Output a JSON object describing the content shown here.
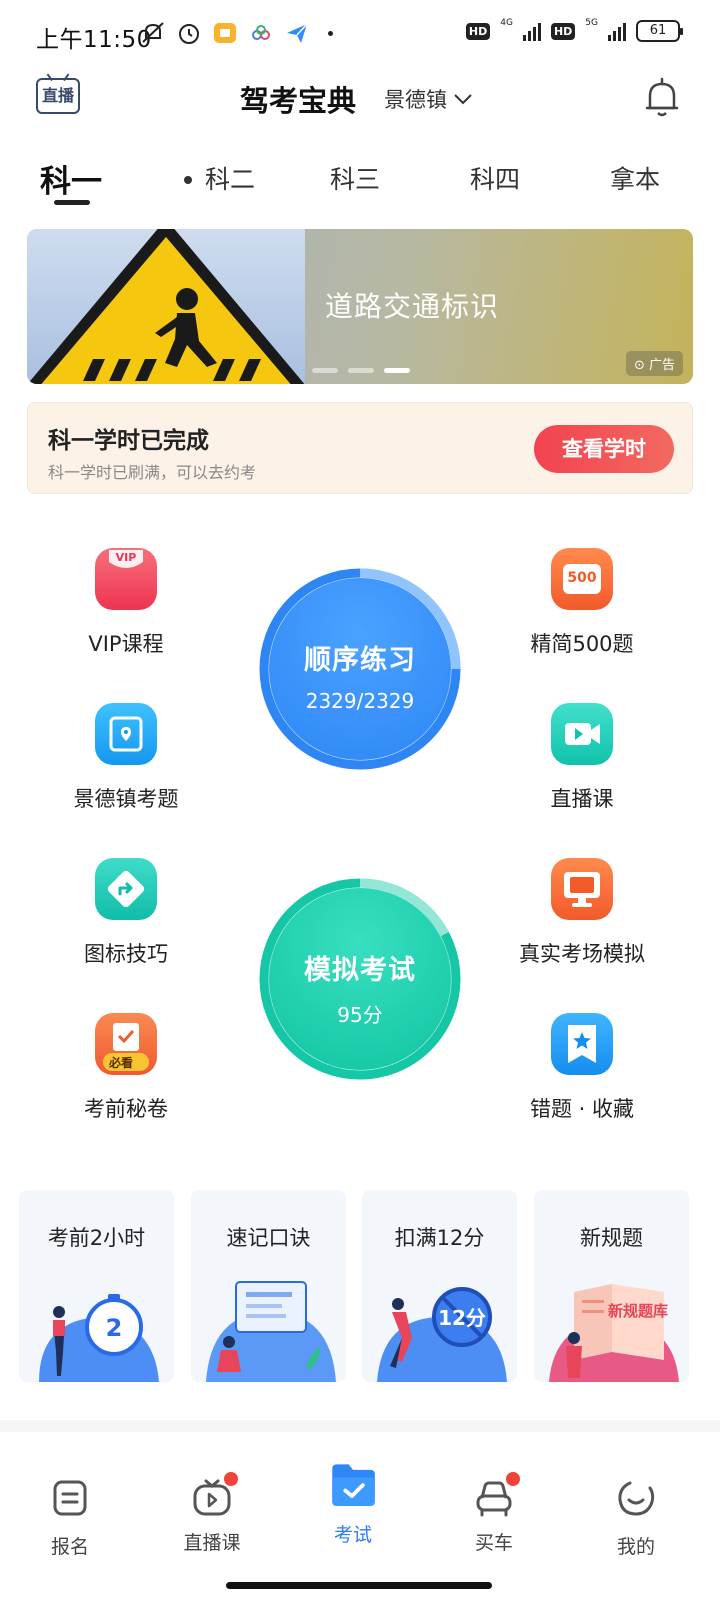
{
  "status_bar": {
    "time": "上午11:50",
    "net1": "4G",
    "net2": "5G",
    "hd": "HD",
    "battery": "61"
  },
  "header": {
    "live_label": "直播",
    "title": "驾考宝典",
    "city": "景德镇"
  },
  "tabs": [
    {
      "label": "科一",
      "active": true
    },
    {
      "label": "科二",
      "active": false
    },
    {
      "label": "科三",
      "active": false
    },
    {
      "label": "科四",
      "active": false
    },
    {
      "label": "拿本",
      "active": false
    }
  ],
  "banner": {
    "text": "道路交通标识",
    "ad_label": "广告",
    "page_count": 3,
    "current_page": 3
  },
  "study_hours": {
    "title": "科一学时已完成",
    "subtitle": "科一学时已刷满，可以去约考",
    "button": "查看学时"
  },
  "features_left": [
    {
      "label": "VIP课程",
      "icon": "vip-icon",
      "color": "#f2465a"
    },
    {
      "label": "景德镇考题",
      "icon": "location-icon",
      "color": "#19a7f2"
    },
    {
      "label": "图标技巧",
      "icon": "direction-sign-icon",
      "color": "#16c8b5"
    },
    {
      "label": "考前秘卷",
      "icon": "exam-paper-icon",
      "color": "#f36f3d",
      "badge": "必看"
    }
  ],
  "features_right": [
    {
      "label": "精简500题",
      "icon": "500-icon",
      "color": "#f36a3c",
      "badge": "500"
    },
    {
      "label": "直播课",
      "icon": "video-icon",
      "color": "#14cbb4"
    },
    {
      "label": "真实考场模拟",
      "icon": "monitor-icon",
      "color": "#f36a3c"
    },
    {
      "label": "错题 · 收藏",
      "icon": "star-bookmark-icon",
      "color": "#1a9ff0"
    }
  ],
  "practice": {
    "title": "顺序练习",
    "progress": "2329/2329",
    "color": "#2f8df6"
  },
  "mock_exam": {
    "title": "模拟考试",
    "score": "95分",
    "color": "#14c9a8"
  },
  "promos": [
    {
      "title": "考前2小时",
      "art_text": "2"
    },
    {
      "title": "速记口诀"
    },
    {
      "title": "扣满12分",
      "art_text": "12分"
    },
    {
      "title": "新规题",
      "art_text": "新规题库"
    }
  ],
  "bottom_nav": [
    {
      "label": "报名",
      "icon": "signup-icon",
      "active": false,
      "dot": false
    },
    {
      "label": "直播课",
      "icon": "tv-icon",
      "active": false,
      "dot": true
    },
    {
      "label": "考试",
      "icon": "exam-folder-icon",
      "active": true,
      "dot": false
    },
    {
      "label": "买车",
      "icon": "car-icon",
      "active": false,
      "dot": true
    },
    {
      "label": "我的",
      "icon": "profile-icon",
      "active": false,
      "dot": false
    }
  ]
}
